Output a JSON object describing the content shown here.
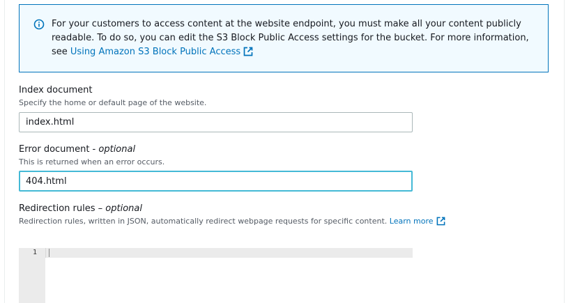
{
  "info": {
    "text": "For your customers to access content at the website endpoint, you must make all your content publicly readable. To do so, you can edit the S3 Block Public Access settings for the bucket. For more information, see",
    "link": "Using Amazon S3 Block Public Access",
    "icon": "info-icon"
  },
  "index_document": {
    "label": "Index document",
    "description": "Specify the home or default page of the website.",
    "value": "index.html"
  },
  "error_document": {
    "label": "Error document",
    "label_suffix": "optional",
    "separator": " - ",
    "description": "This is returned when an error occurs.",
    "value": "404.html"
  },
  "redirection_rules": {
    "label": "Redirection rules",
    "label_suffix": "optional",
    "separator": " – ",
    "description": "Redirection rules, written in JSON, automatically redirect webpage requests for specific content.",
    "learn_more": "Learn more",
    "line_number": "1"
  },
  "colors": {
    "link": "#0073bb",
    "info_bg": "#f1faff",
    "info_border": "#0073bb",
    "focus_border": "#44b9d6"
  }
}
